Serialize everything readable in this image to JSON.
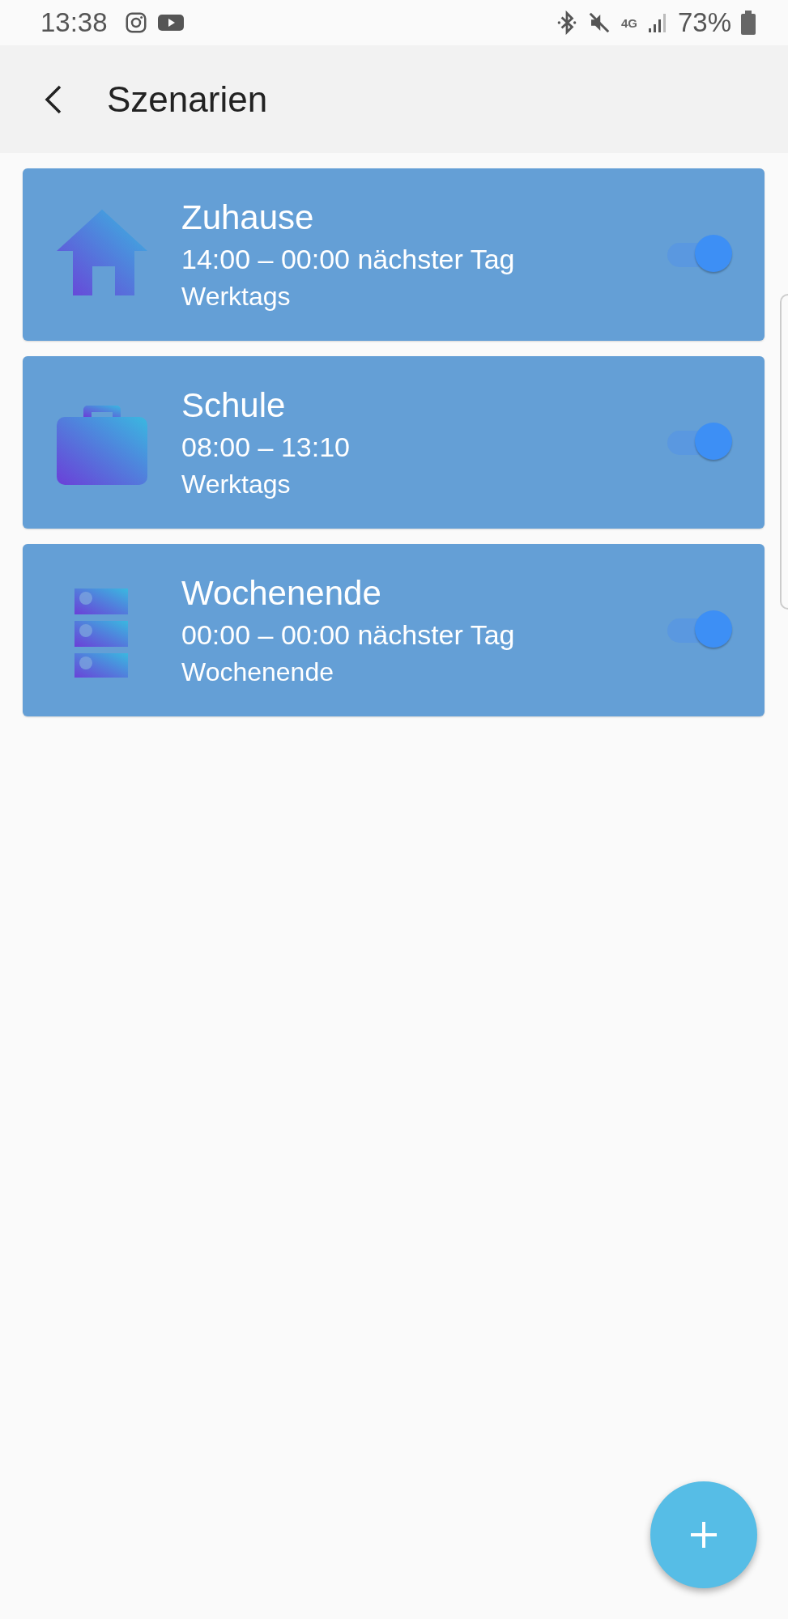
{
  "status_bar": {
    "time": "13:38",
    "network": "4G",
    "battery": "73%"
  },
  "header": {
    "title": "Szenarien"
  },
  "scenarios": [
    {
      "kind": "house",
      "name": "Zuhause",
      "time": "14:00 – 00:00 nächster Tag",
      "days": "Werktags",
      "on": true
    },
    {
      "kind": "briefcase",
      "name": "Schule",
      "time": "08:00 – 13:10",
      "days": "Werktags",
      "on": true
    },
    {
      "kind": "stack",
      "name": "Wochenende",
      "time": "00:00 – 00:00 nächster Tag",
      "days": "Wochenende",
      "on": true
    }
  ]
}
